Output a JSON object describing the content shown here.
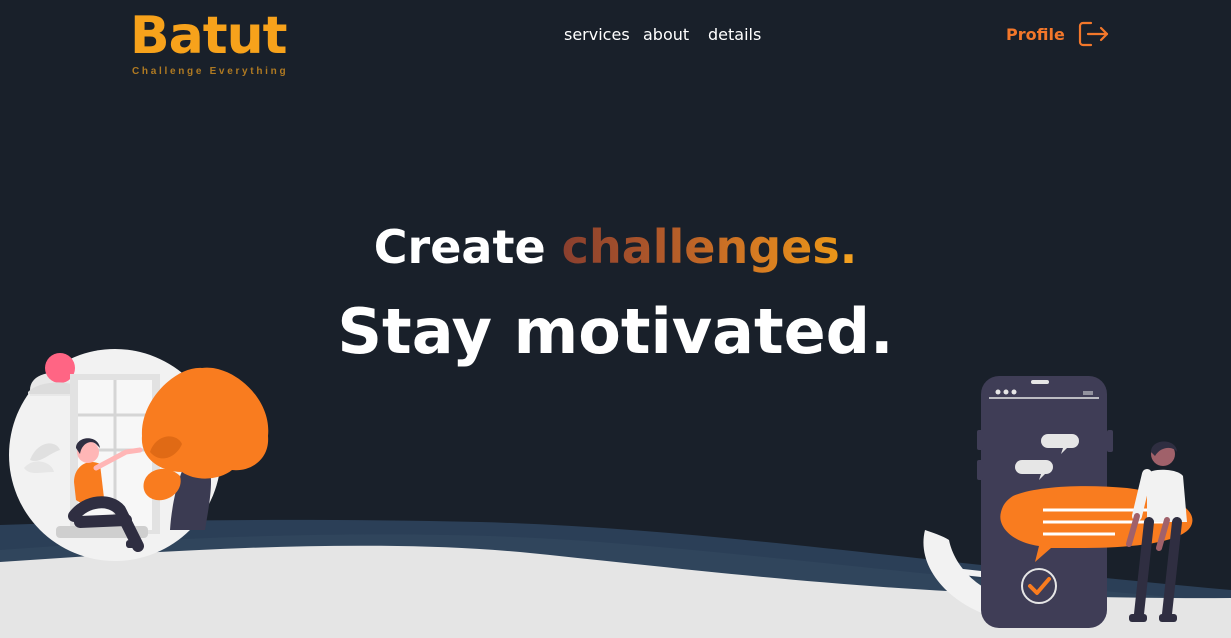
{
  "brand": {
    "name": "Batut",
    "tagline": "Challenge Everything",
    "color": "#f7a21b"
  },
  "nav": {
    "items": [
      {
        "label": "services"
      },
      {
        "label": "about"
      },
      {
        "label": "details"
      }
    ]
  },
  "profile": {
    "label": "Profile",
    "icon": "logout-icon",
    "color": "#f3772a"
  },
  "hero": {
    "line1": {
      "word1": "Create",
      "word2": "challenges",
      "punct": "."
    },
    "line2": "Stay motivated."
  },
  "colors": {
    "background": "#19202a",
    "accent_orange": "#f97c1f",
    "ground": "#e5e5e5",
    "wave_blue": "#2b3f57"
  },
  "illustrations": {
    "left": "person-reading-window-illustration",
    "right": "person-phone-chat-illustration"
  }
}
